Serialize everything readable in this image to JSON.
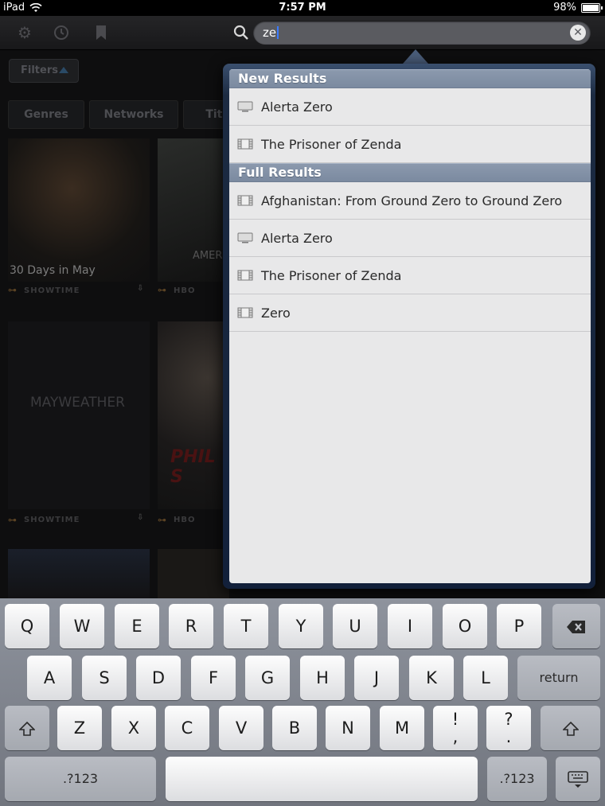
{
  "status_bar": {
    "device": "iPad",
    "time": "7:57 PM",
    "battery": "98%"
  },
  "search": {
    "value": "ze",
    "clear_icon": "clear-icon"
  },
  "filters_label": "Filters",
  "tabs": [
    "Genres",
    "Networks",
    "Title"
  ],
  "background_tiles": [
    {
      "caption": "30 Days in May",
      "network": "SHOWTIME"
    },
    {
      "caption": "AMERICAN WINTER",
      "network": "HBO"
    },
    {
      "caption": "MAYWEATHER",
      "network": "SHOWTIME"
    },
    {
      "caption": "PHIL S",
      "network": "HBO"
    }
  ],
  "results": {
    "new_header": "New Results",
    "new_items": [
      {
        "title": "Alerta Zero",
        "type_icon": "tv-icon"
      },
      {
        "title": "The Prisoner of Zenda",
        "type_icon": "film-icon"
      }
    ],
    "full_header": "Full Results",
    "full_items": [
      {
        "title": "Afghanistan: From Ground Zero to Ground Zero",
        "type_icon": "film-icon"
      },
      {
        "title": "Alerta Zero",
        "type_icon": "tv-icon"
      },
      {
        "title": "The Prisoner of Zenda",
        "type_icon": "film-icon"
      },
      {
        "title": "Zero",
        "type_icon": "film-icon"
      }
    ]
  },
  "keyboard": {
    "row1": [
      "Q",
      "W",
      "E",
      "R",
      "T",
      "Y",
      "U",
      "I",
      "O",
      "P"
    ],
    "row2": [
      "A",
      "S",
      "D",
      "F",
      "G",
      "H",
      "J",
      "K",
      "L"
    ],
    "return": "return",
    "row3": [
      "Z",
      "X",
      "C",
      "V",
      "B",
      "N",
      "M"
    ],
    "excl_top": "!",
    "excl_bottom": ",",
    "q_top": "?",
    "q_bottom": ".",
    "numbers_left": ".?123",
    "numbers_right": ".?123"
  },
  "colors": {
    "accent": "#3b7bff",
    "header_blue": "#7b8aa0"
  }
}
